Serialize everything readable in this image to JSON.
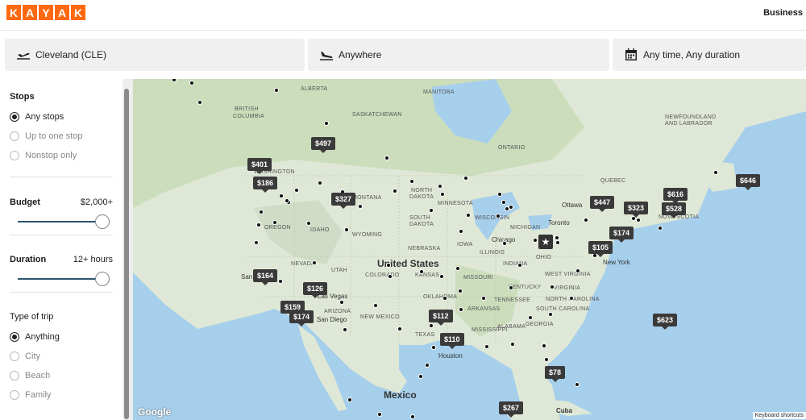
{
  "header": {
    "logo_letters": [
      "K",
      "A",
      "Y",
      "A",
      "K"
    ],
    "business_label": "Business"
  },
  "search": {
    "origin": "Cleveland (CLE)",
    "destination": "Anywhere",
    "dates": "Any time, Any duration"
  },
  "filters": {
    "stops": {
      "title": "Stops",
      "options": [
        "Any stops",
        "Up to one stop",
        "Nonstop only"
      ]
    },
    "budget": {
      "title": "Budget",
      "value": "$2,000+",
      "fill": 1.0
    },
    "duration": {
      "title": "Duration",
      "value": "12+ hours",
      "fill": 1.0
    },
    "trip_type": {
      "title": "Type of trip",
      "options": [
        "Anything",
        "City",
        "Beach",
        "Family"
      ]
    }
  },
  "map": {
    "labels": {
      "alberta": "ALBERTA",
      "manitoba": "MANITOBA",
      "saskatchewan": "SASKATCHEWAN",
      "british_columbia_1": "BRITISH",
      "british_columbia_2": "COLUMBIA",
      "ontario": "ONTARIO",
      "quebec": "QUEBEC",
      "nfl_1": "NEWFOUNDLAND",
      "nfl_2": "AND LABRADOR",
      "washington": "WASHINGTON",
      "oregon": "OREGON",
      "idaho": "IDAHO",
      "nevada": "NEVADA",
      "utah": "UTAH",
      "wyoming": "WYOMING",
      "colorado": "COLORADO",
      "arizona": "ARIZONA",
      "new_mexico": "NEW MEXICO",
      "texas": "TEXAS",
      "north_dakota_1": "NORTH",
      "north_dakota_2": "DAKOTA",
      "south_dakota_1": "SOUTH",
      "south_dakota_2": "DAKOTA",
      "nebraska": "NEBRASKA",
      "kansas": "KANSAS",
      "oklahoma": "OKLAHOMA",
      "minnesota": "MINNESOTA",
      "iowa": "IOWA",
      "missouri": "MISSOURI",
      "arkansas": "ARKANSAS",
      "wisconsin": "WISCONSIN",
      "illinois": "ILLINOIS",
      "michigan": "MICHIGAN",
      "indiana": "INDIANA",
      "ohio": "OHIO",
      "kentucky": "KENTUCKY",
      "tennessee": "TENNESSEE",
      "mississippi": "MISSISSIPPI",
      "alabama": "ALABAMA",
      "georgia": "GEORGIA",
      "south_carolina": "SOUTH CAROLINA",
      "north_carolina": "NORTH CAROLINA",
      "virginia": "VIRGINIA",
      "west_virginia": "WEST VIRGINIA",
      "nova_scotia": "NOVA SCOTIA",
      "montana": "MONTANA",
      "united_states": "United States",
      "mexico": "Mexico",
      "cuba": "Cuba",
      "chicago": "Chicago",
      "toronto": "Toronto",
      "ottawa": "Ottawa",
      "new_york": "New York",
      "las_vegas": "Las Vegas",
      "san_diego": "San Diego",
      "houston": "Houston",
      "san_francisco": "San"
    },
    "prices": [
      "$497",
      "$401",
      "$186",
      "$327",
      "$447",
      "$323",
      "$616",
      "$528",
      "$646",
      "$174",
      "$105",
      "$164",
      "$126",
      "$159",
      "$174",
      "$112",
      "$110",
      "$623",
      "$78",
      "$267"
    ],
    "google_label": "Google",
    "keyboard_label": "Keyboard shortcuts",
    "colors": {
      "water": "#a6cfec",
      "land": "#dfe8d6",
      "green": "#bcd3a9",
      "price_bg": "#3a3a3a",
      "brand": "#ff690f"
    }
  }
}
